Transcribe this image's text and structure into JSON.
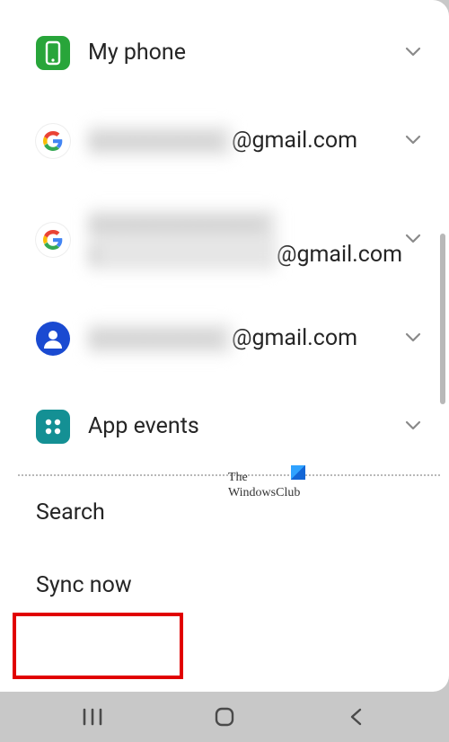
{
  "accounts": [
    {
      "icon": "phone",
      "label": "My phone",
      "redacted": false
    },
    {
      "icon": "google",
      "label": "@gmail.com",
      "redacted": true,
      "redactedWidth": "160px"
    },
    {
      "icon": "google",
      "label": "@gmail.com",
      "redacted": true,
      "redactedWidth": "220px"
    },
    {
      "icon": "samsung-contacts",
      "label": "@gmail.com",
      "redacted": true,
      "redactedWidth": "160px"
    },
    {
      "icon": "app-events",
      "label": "App events",
      "redacted": false
    }
  ],
  "actions": {
    "search": "Search",
    "sync": "Sync now"
  },
  "watermark": {
    "line1": "The",
    "line2": "WindowsClub"
  }
}
